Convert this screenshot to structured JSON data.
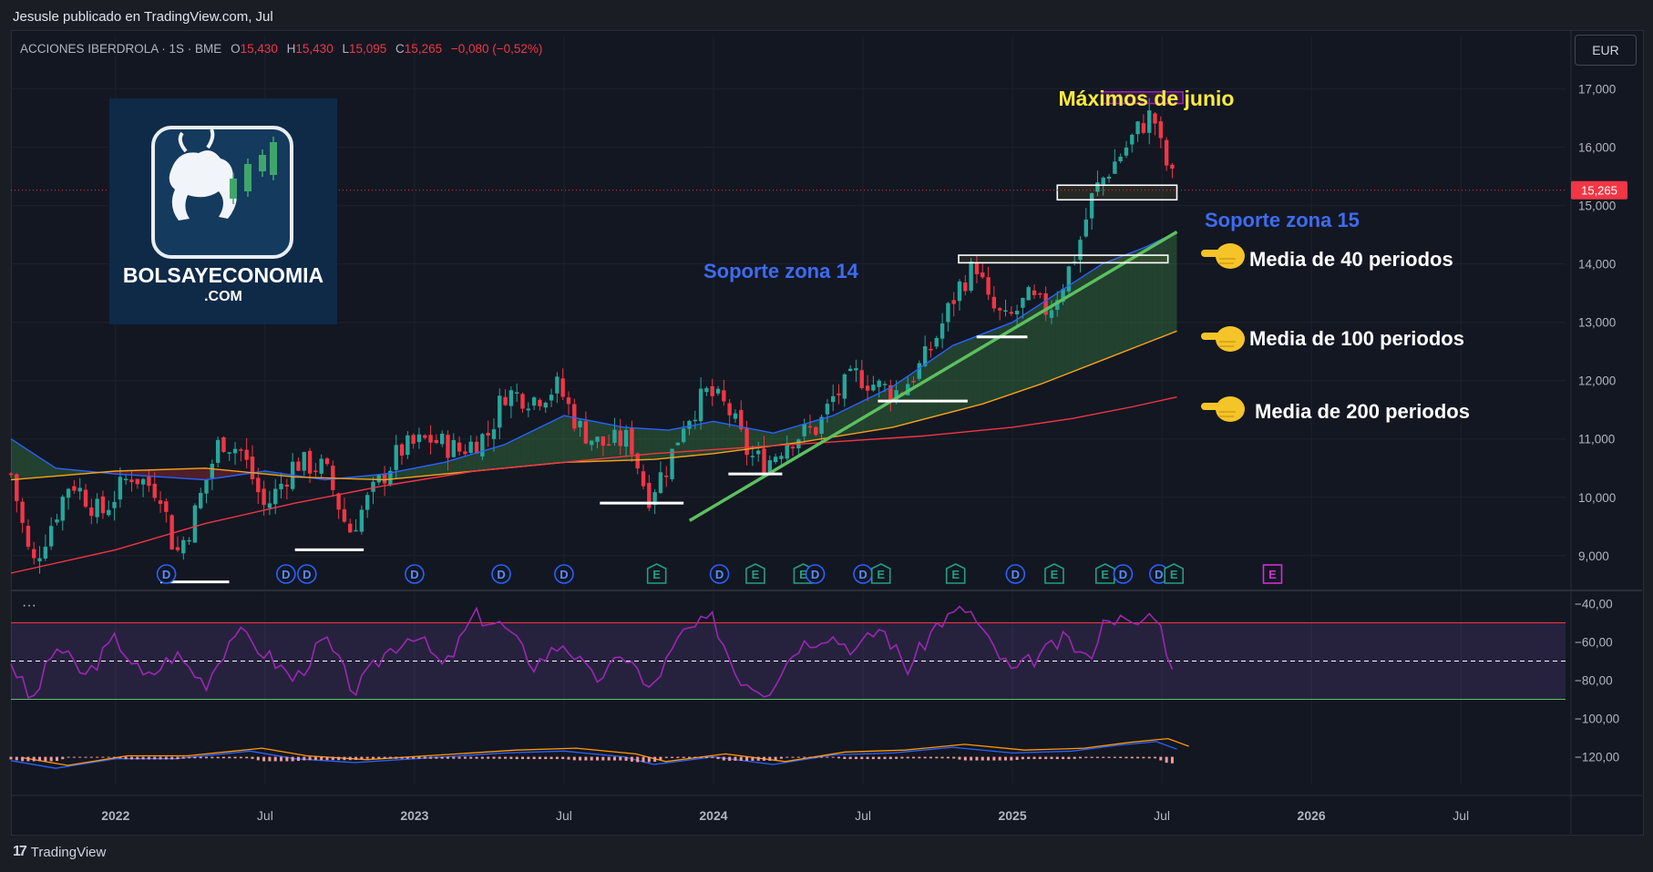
{
  "header": {
    "title": "Jesusle publicado en TradingView.com, Jul"
  },
  "legend": {
    "symbol": "ACCIONES IBERDROLA · 1S · BME",
    "o_label": "O",
    "o": "15,430",
    "h_label": "H",
    "h": "15,430",
    "l_label": "L",
    "l": "15,095",
    "c_label": "C",
    "c": "15,265",
    "change": "−0,080 (−0,52%)"
  },
  "currency_button": "EUR",
  "indicator_menu": "···",
  "footer": {
    "logo": "17",
    "brand": "TradingView"
  },
  "colors": {
    "up": "#26a69a",
    "down": "#f23645",
    "ma40": "#2962ff",
    "ma100": "#f7a21b",
    "ma200": "#f23645",
    "trend": "#5cc05f",
    "rsi": "#9c27b0",
    "bg": "#131722"
  },
  "chart_data": {
    "type": "candlestick",
    "price_axis": {
      "ticks": [
        "17,000",
        "16,000",
        "15,000",
        "14,000",
        "13,000",
        "12,000",
        "11,000",
        "10,000",
        "9,000"
      ],
      "tick_values": [
        17,
        16,
        15,
        14,
        13,
        12,
        11,
        10,
        9
      ],
      "ylim": [
        8.45,
        17.9
      ]
    },
    "current_price": "15,265",
    "time_axis": {
      "ticks": [
        "2022",
        "Jul",
        "2023",
        "Jul",
        "2024",
        "Jul",
        "2025",
        "Jul",
        "2026",
        "Jul"
      ],
      "tick_values": [
        2022.0,
        2022.5,
        2023.0,
        2023.5,
        2024.0,
        2024.5,
        2025.0,
        2025.5,
        2026.0,
        2026.5
      ]
    },
    "x_range": [
      2021.65,
      2026.85
    ],
    "last_date": 2025.55,
    "price_path": [
      [
        2021.65,
        10.4
      ],
      [
        2021.72,
        8.8
      ],
      [
        2021.85,
        10.3
      ],
      [
        2021.95,
        9.7
      ],
      [
        2022.05,
        10.4
      ],
      [
        2022.15,
        10.1
      ],
      [
        2022.2,
        9.0
      ],
      [
        2022.25,
        9.5
      ],
      [
        2022.35,
        11.0
      ],
      [
        2022.42,
        10.8
      ],
      [
        2022.5,
        9.8
      ],
      [
        2022.6,
        10.6
      ],
      [
        2022.7,
        10.5
      ],
      [
        2022.78,
        9.4
      ],
      [
        2022.85,
        10.0
      ],
      [
        2022.95,
        10.8
      ],
      [
        2023.05,
        11.0
      ],
      [
        2023.15,
        10.8
      ],
      [
        2023.25,
        11.1
      ],
      [
        2023.3,
        11.8
      ],
      [
        2023.4,
        11.7
      ],
      [
        2023.48,
        11.9
      ],
      [
        2023.55,
        11.2
      ],
      [
        2023.62,
        10.9
      ],
      [
        2023.72,
        11.0
      ],
      [
        2023.78,
        10.0
      ],
      [
        2023.85,
        10.6
      ],
      [
        2023.9,
        11.3
      ],
      [
        2023.98,
        11.8
      ],
      [
        2024.05,
        11.5
      ],
      [
        2024.12,
        10.7
      ],
      [
        2024.18,
        10.6
      ],
      [
        2024.25,
        11.0
      ],
      [
        2024.35,
        11.2
      ],
      [
        2024.4,
        11.7
      ],
      [
        2024.48,
        12.1
      ],
      [
        2024.55,
        11.9
      ],
      [
        2024.62,
        11.8
      ],
      [
        2024.7,
        12.3
      ],
      [
        2024.75,
        12.8
      ],
      [
        2024.82,
        13.6
      ],
      [
        2024.88,
        14.0
      ],
      [
        2024.92,
        13.3
      ],
      [
        2024.98,
        13.0
      ],
      [
        2025.05,
        13.4
      ],
      [
        2025.12,
        13.2
      ],
      [
        2025.18,
        13.8
      ],
      [
        2025.22,
        14.3
      ],
      [
        2025.27,
        15.2
      ],
      [
        2025.32,
        15.6
      ],
      [
        2025.38,
        16.0
      ],
      [
        2025.42,
        16.3
      ],
      [
        2025.47,
        16.6
      ],
      [
        2025.5,
        15.9
      ],
      [
        2025.55,
        15.27
      ]
    ],
    "moving_averages": [
      {
        "name": "Media de 40 periodos",
        "values": [
          [
            2021.65,
            11.0
          ],
          [
            2021.8,
            10.5
          ],
          [
            2022.0,
            10.4
          ],
          [
            2022.3,
            10.3
          ],
          [
            2022.5,
            10.45
          ],
          [
            2022.7,
            10.3
          ],
          [
            2022.9,
            10.4
          ],
          [
            2023.1,
            10.6
          ],
          [
            2023.3,
            10.9
          ],
          [
            2023.5,
            11.4
          ],
          [
            2023.7,
            11.2
          ],
          [
            2023.85,
            11.15
          ],
          [
            2024.0,
            11.3
          ],
          [
            2024.2,
            11.1
          ],
          [
            2024.4,
            11.4
          ],
          [
            2024.6,
            11.9
          ],
          [
            2024.8,
            12.6
          ],
          [
            2025.0,
            13.0
          ],
          [
            2025.15,
            13.5
          ],
          [
            2025.3,
            14.0
          ],
          [
            2025.45,
            14.3
          ],
          [
            2025.55,
            14.55
          ]
        ]
      },
      {
        "name": "Media de 100 periodos",
        "values": [
          [
            2021.65,
            10.3
          ],
          [
            2022.0,
            10.45
          ],
          [
            2022.3,
            10.5
          ],
          [
            2022.6,
            10.35
          ],
          [
            2022.9,
            10.3
          ],
          [
            2023.2,
            10.45
          ],
          [
            2023.5,
            10.6
          ],
          [
            2023.8,
            10.65
          ],
          [
            2024.0,
            10.75
          ],
          [
            2024.3,
            10.95
          ],
          [
            2024.6,
            11.2
          ],
          [
            2024.9,
            11.6
          ],
          [
            2025.1,
            11.95
          ],
          [
            2025.3,
            12.35
          ],
          [
            2025.45,
            12.65
          ],
          [
            2025.55,
            12.85
          ]
        ]
      },
      {
        "name": "Media de 200 periodos",
        "values": [
          [
            2021.65,
            8.7
          ],
          [
            2022.0,
            9.1
          ],
          [
            2022.3,
            9.55
          ],
          [
            2022.6,
            9.9
          ],
          [
            2022.9,
            10.2
          ],
          [
            2023.2,
            10.45
          ],
          [
            2023.5,
            10.6
          ],
          [
            2023.8,
            10.75
          ],
          [
            2024.1,
            10.85
          ],
          [
            2024.4,
            10.95
          ],
          [
            2024.7,
            11.05
          ],
          [
            2025.0,
            11.2
          ],
          [
            2025.2,
            11.35
          ],
          [
            2025.4,
            11.55
          ],
          [
            2025.55,
            11.72
          ]
        ]
      }
    ],
    "trendline": [
      [
        2023.92,
        9.6
      ],
      [
        2025.55,
        14.55
      ]
    ],
    "support_boxes": [
      {
        "label": "Soporte zona 14",
        "x": [
          2024.82,
          2025.52
        ],
        "y": [
          14.02,
          14.15
        ]
      },
      {
        "label": "Soporte zona 15",
        "x": [
          2025.15,
          2025.55
        ],
        "y": [
          15.1,
          15.35
        ]
      }
    ],
    "top_box": {
      "label": "Máximos de junio",
      "x": [
        2025.3,
        2025.57
      ],
      "y": [
        16.75,
        16.95
      ]
    },
    "support_lines": [
      [
        2022.15,
        2022.38,
        8.55
      ],
      [
        2022.6,
        2022.83,
        9.1
      ],
      [
        2023.62,
        2023.9,
        9.9
      ],
      [
        2024.05,
        2024.23,
        10.4
      ],
      [
        2024.55,
        2024.85,
        11.65
      ],
      [
        2024.88,
        2025.05,
        12.75
      ]
    ],
    "event_markers": [
      {
        "label": "D",
        "x": 2022.17
      },
      {
        "label": "D",
        "x": 2022.57
      },
      {
        "label": "D",
        "x": 2022.64
      },
      {
        "label": "D",
        "x": 2023.0
      },
      {
        "label": "D",
        "x": 2023.29
      },
      {
        "label": "D",
        "x": 2023.5
      },
      {
        "label": "E",
        "x": 2023.81
      },
      {
        "label": "D",
        "x": 2024.02
      },
      {
        "label": "E",
        "x": 2024.14
      },
      {
        "label": "E",
        "x": 2024.3
      },
      {
        "label": "D",
        "x": 2024.34
      },
      {
        "label": "D",
        "x": 2024.5
      },
      {
        "label": "E",
        "x": 2024.56
      },
      {
        "label": "E",
        "x": 2024.81
      },
      {
        "label": "D",
        "x": 2025.01
      },
      {
        "label": "E",
        "x": 2025.14
      },
      {
        "label": "E",
        "x": 2025.31
      },
      {
        "label": "D",
        "x": 2025.37
      },
      {
        "label": "D",
        "x": 2025.49
      },
      {
        "label": "E",
        "x": 2025.54
      },
      {
        "label": "E",
        "x": 2025.87,
        "future": true
      }
    ],
    "annotations": [
      "Máximos de junio",
      "Soporte zona 15",
      "Soporte zona 14",
      "Media de 40 periodos",
      "Media de 100 periodos",
      "Media de 200 periodos"
    ],
    "oscillator": {
      "axis_ticks": [
        "−40,00",
        "−60,00",
        "−80,00",
        "−100,00",
        "−120,00"
      ],
      "tick_values": [
        -40,
        -60,
        -80,
        -100,
        -120
      ],
      "ylim": [
        -134,
        -35
      ],
      "band_upper": -50,
      "band_mid": -70,
      "band_lower": -90,
      "rsi_path": [
        [
          2021.65,
          -70
        ],
        [
          2021.72,
          -92
        ],
        [
          2021.8,
          -62
        ],
        [
          2021.9,
          -78
        ],
        [
          2022.0,
          -58
        ],
        [
          2022.1,
          -80
        ],
        [
          2022.2,
          -66
        ],
        [
          2022.3,
          -82
        ],
        [
          2022.4,
          -54
        ],
        [
          2022.5,
          -66
        ],
        [
          2022.6,
          -80
        ],
        [
          2022.7,
          -58
        ],
        [
          2022.8,
          -86
        ],
        [
          2022.9,
          -66
        ],
        [
          2023.0,
          -55
        ],
        [
          2023.1,
          -74
        ],
        [
          2023.2,
          -46
        ],
        [
          2023.3,
          -52
        ],
        [
          2023.4,
          -72
        ],
        [
          2023.5,
          -60
        ],
        [
          2023.6,
          -80
        ],
        [
          2023.72,
          -66
        ],
        [
          2023.78,
          -87
        ],
        [
          2023.9,
          -55
        ],
        [
          2024.0,
          -48
        ],
        [
          2024.08,
          -78
        ],
        [
          2024.18,
          -86
        ],
        [
          2024.28,
          -62
        ],
        [
          2024.38,
          -56
        ],
        [
          2024.48,
          -64
        ],
        [
          2024.56,
          -52
        ],
        [
          2024.65,
          -74
        ],
        [
          2024.75,
          -50
        ],
        [
          2024.85,
          -42
        ],
        [
          2024.92,
          -60
        ],
        [
          2025.0,
          -76
        ],
        [
          2025.08,
          -68
        ],
        [
          2025.18,
          -58
        ],
        [
          2025.25,
          -70
        ],
        [
          2025.32,
          -45
        ],
        [
          2025.4,
          -52
        ],
        [
          2025.48,
          -44
        ],
        [
          2025.52,
          -66
        ],
        [
          2025.55,
          -75
        ]
      ],
      "macd_path": [
        [
          2021.65,
          -122
        ],
        [
          2021.8,
          -126
        ],
        [
          2022.0,
          -121
        ],
        [
          2022.2,
          -121
        ],
        [
          2022.45,
          -117
        ],
        [
          2022.6,
          -121
        ],
        [
          2022.8,
          -123
        ],
        [
          2023.0,
          -121
        ],
        [
          2023.3,
          -118
        ],
        [
          2023.5,
          -117
        ],
        [
          2023.7,
          -120
        ],
        [
          2023.8,
          -124
        ],
        [
          2024.0,
          -120
        ],
        [
          2024.2,
          -124
        ],
        [
          2024.4,
          -119
        ],
        [
          2024.6,
          -118
        ],
        [
          2024.8,
          -115
        ],
        [
          2025.0,
          -118
        ],
        [
          2025.2,
          -117
        ],
        [
          2025.35,
          -114
        ],
        [
          2025.48,
          -112
        ],
        [
          2025.55,
          -116
        ]
      ]
    }
  }
}
